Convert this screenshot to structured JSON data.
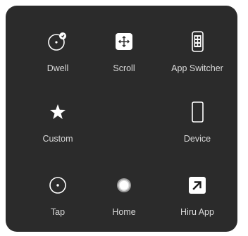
{
  "menu": {
    "items": [
      {
        "id": "dwell",
        "label": "Dwell",
        "icon": "dwell-icon"
      },
      {
        "id": "scroll",
        "label": "Scroll",
        "icon": "scroll-icon"
      },
      {
        "id": "app-switcher",
        "label": "App Switcher",
        "icon": "app-switcher-icon"
      },
      {
        "id": "custom",
        "label": "Custom",
        "icon": "star-icon"
      },
      {
        "id": "device",
        "label": "Device",
        "icon": "device-icon"
      },
      {
        "id": "tap",
        "label": "Tap",
        "icon": "tap-icon"
      },
      {
        "id": "home",
        "label": "Home",
        "icon": "home-button-icon"
      },
      {
        "id": "hiru-app",
        "label": "Hiru App",
        "icon": "arrow-up-right-icon"
      }
    ]
  },
  "colors": {
    "panel_background": "#2b2b2b",
    "icon_color": "#ffffff",
    "label_color": "#d9d9d9"
  }
}
